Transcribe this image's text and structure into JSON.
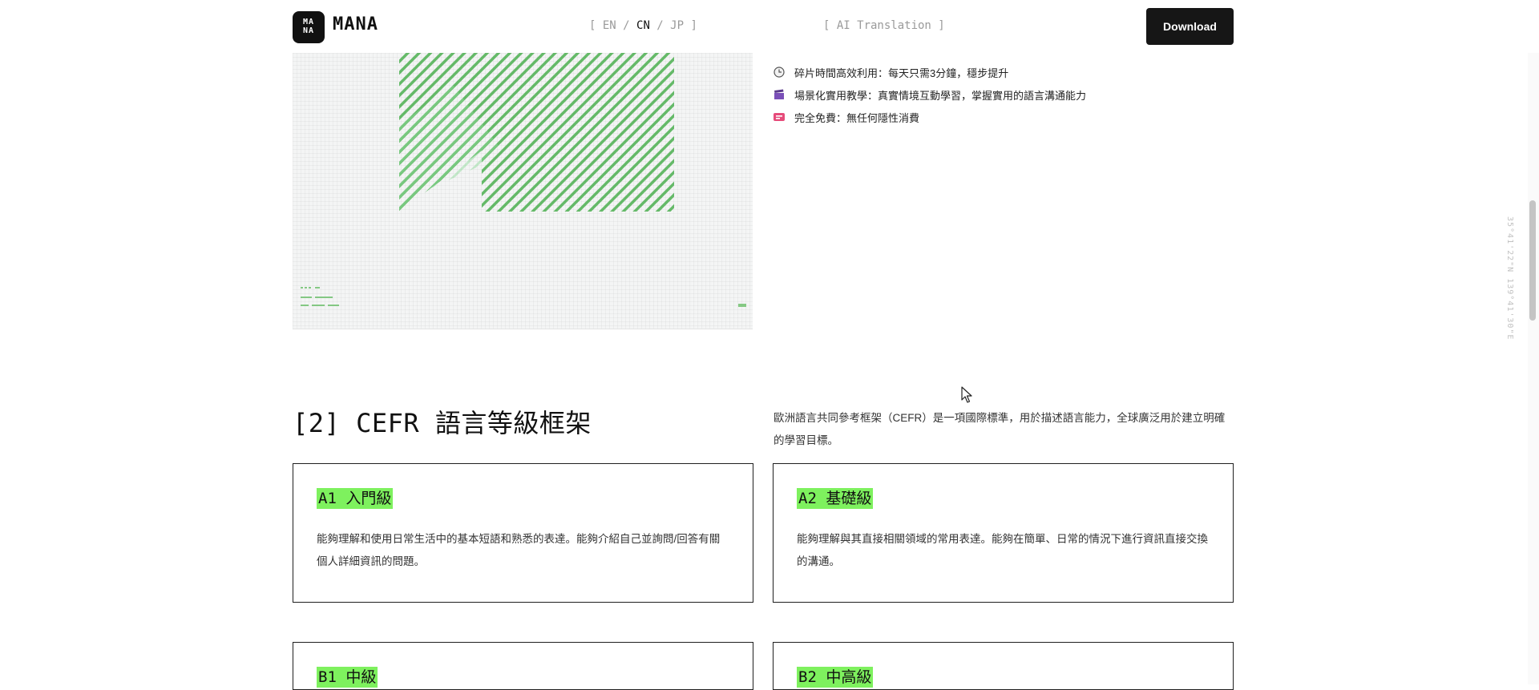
{
  "header": {
    "logo_mark": "MA\nNA",
    "logo_text": "MANA",
    "lang_open": "[ ",
    "langs": [
      "EN",
      "CN",
      "JP"
    ],
    "lang_sep": " / ",
    "lang_close": " ]",
    "ai_translation": "[ AI Translation ]",
    "download_label": "Download"
  },
  "features": [
    {
      "icon": "clock-icon",
      "text": "碎片時間高效利用：每天只需3分鐘，穩步提升"
    },
    {
      "icon": "clapperboard-icon",
      "text": "場景化實用教學：真實情境互動學習，掌握實用的語言溝通能力"
    },
    {
      "icon": "free-icon",
      "text": "完全免費：無任何隱性消費"
    }
  ],
  "section": {
    "title": "[2] CEFR 語言等級框架",
    "description": "歐洲語言共同參考框架（CEFR）是一項國際標準，用於描述語言能力，全球廣泛用於建立明確的學習目標。"
  },
  "cards": [
    {
      "title": "A1 入門級",
      "description": "能夠理解和使用日常生活中的基本短語和熟悉的表達。能夠介紹自己並詢問/回答有關個人詳細資訊的問題。"
    },
    {
      "title": "A2 基礎級",
      "description": "能夠理解與其直接相關領域的常用表達。能夠在簡單、日常的情況下進行資訊直接交換的溝通。"
    },
    {
      "title": "B1 中級",
      "description": ""
    },
    {
      "title": "B2 中高級",
      "description": ""
    }
  ],
  "sidebar_coords": "35°41'22\"N 139°41'30\"E",
  "colors": {
    "accent_green": "#7ef15e",
    "button_dark": "#161616"
  }
}
